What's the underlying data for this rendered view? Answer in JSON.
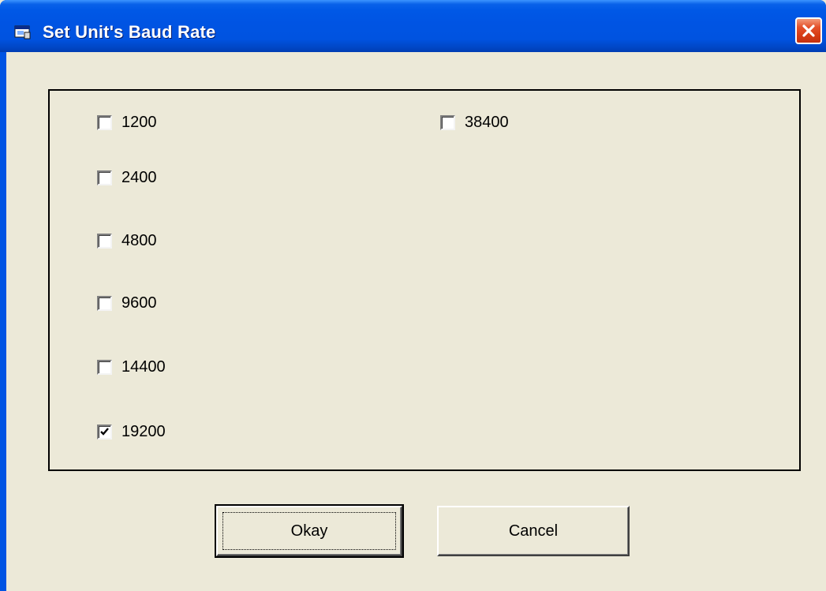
{
  "window": {
    "title": "Set Unit's Baud Rate",
    "titlebar_color": "#0054e3",
    "close_button_color": "#e4512a",
    "app_icon": "app-window-icon",
    "close_icon": "close-icon"
  },
  "baud_rates": [
    {
      "label": "1200",
      "checked": false
    },
    {
      "label": "2400",
      "checked": false
    },
    {
      "label": "4800",
      "checked": false
    },
    {
      "label": "9600",
      "checked": false
    },
    {
      "label": "14400",
      "checked": false
    },
    {
      "label": "19200",
      "checked": true
    },
    {
      "label": "38400",
      "checked": false
    }
  ],
  "buttons": {
    "okay_label": "Okay",
    "cancel_label": "Cancel"
  }
}
